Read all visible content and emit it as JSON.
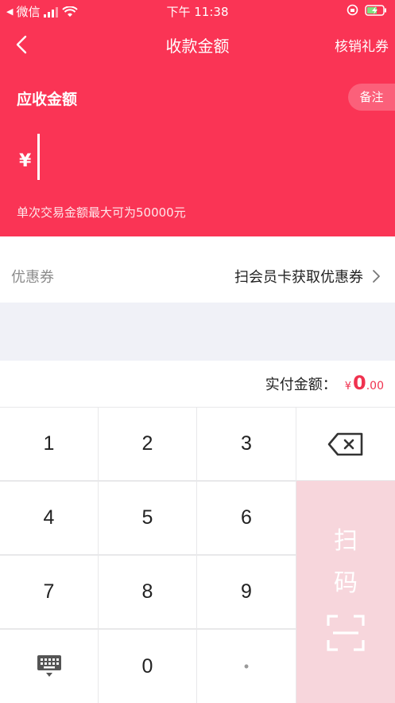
{
  "status_bar": {
    "back_app": "微信",
    "time": "下午 11:38"
  },
  "nav": {
    "title": "收款金额",
    "action": "核销礼券"
  },
  "amount": {
    "label": "应收金额",
    "note_button": "备注",
    "currency_symbol": "¥",
    "limit_text": "单次交易金额最大可为50000元"
  },
  "coupon": {
    "label": "优惠券",
    "action": "扫会员卡获取优惠券"
  },
  "payment": {
    "label": "实付金额：",
    "currency_symbol": "¥",
    "amount_integer": "0",
    "amount_decimal": ".00"
  },
  "keypad": {
    "keys": [
      "1",
      "2",
      "3",
      "4",
      "5",
      "6",
      "7",
      "8",
      "9",
      "0",
      "•"
    ],
    "scan_label_1": "扫",
    "scan_label_2": "码"
  },
  "colors": {
    "brand": "#fa3455",
    "price": "#f0324f",
    "scan_key": "#f7d6dc"
  }
}
